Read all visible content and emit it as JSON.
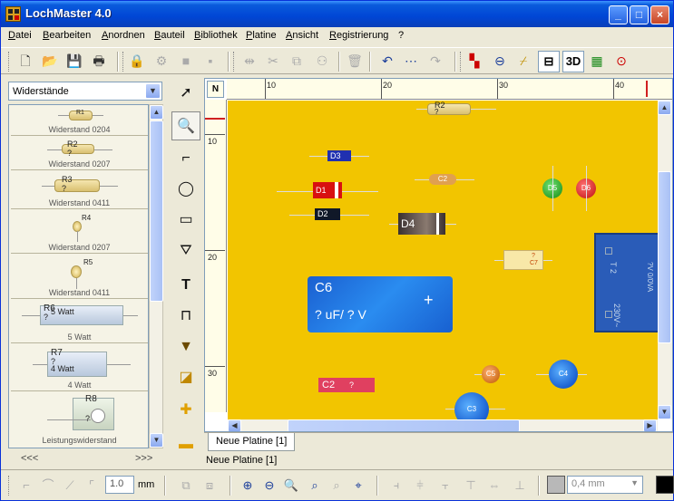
{
  "window": {
    "title": "LochMaster 4.0"
  },
  "title_buttons": {
    "minimize": "_",
    "maximize": "□",
    "close": "×"
  },
  "menu": [
    "Datei",
    "Bearbeiten",
    "Anordnen",
    "Bauteil",
    "Bibliothek",
    "Platine",
    "Ansicht",
    "Registrierung",
    "?"
  ],
  "library": {
    "selected": "Widerstände",
    "parts": [
      {
        "ref": "R1",
        "label": "Widerstand 0204"
      },
      {
        "ref": "R2",
        "value": "?",
        "label": "Widerstand 0207"
      },
      {
        "ref": "R3",
        "value": "?",
        "label": "Widerstand 0411"
      },
      {
        "ref": "R4",
        "label": "Widerstand 0207"
      },
      {
        "ref": "R5",
        "label": "Widerstand 0411"
      },
      {
        "ref": "R6",
        "value": "?",
        "watt": "5 Watt",
        "label": "5 Watt"
      },
      {
        "ref": "R7",
        "value": "?",
        "watt": "4 Watt",
        "label": "4 Watt"
      },
      {
        "ref": "R8",
        "value": "?",
        "label": "Leistungswiderstand"
      }
    ],
    "nav_prev": "<<<",
    "nav_next": ">>>"
  },
  "ruler": {
    "corner": "N",
    "top_labels": [
      "10",
      "20",
      "30",
      "40"
    ],
    "left_labels": [
      "10",
      "20",
      "30"
    ]
  },
  "board": {
    "components": {
      "r2": {
        "ref": "R2",
        "value": "?"
      },
      "d3": "D3",
      "c2": "C2",
      "d1": "D1",
      "d2": "D2",
      "d4": "D4",
      "d5": "D5",
      "d6": "D6",
      "c7": {
        "ref": "C7",
        "value": "?"
      },
      "c6": {
        "ref": "C6",
        "value": "? uF/ ? V"
      },
      "transformer": {
        "ref": "T 2",
        "rating": "230V~",
        "secondary": "?V 0/0VA"
      },
      "c2b": {
        "ref": "C2",
        "value": "?"
      },
      "c5": "C5",
      "c4": "C4",
      "c3": "C3"
    }
  },
  "tabs": [
    "Neue Platine [1]"
  ],
  "status": "Neue Platine [1]",
  "bottom": {
    "line_width": "1.0",
    "unit": "mm",
    "trace_width": "0,4 mm"
  },
  "colors": {
    "board": "#f2c500",
    "title_blue": "#0046d5",
    "elko_blue": "#1a5fd0"
  }
}
